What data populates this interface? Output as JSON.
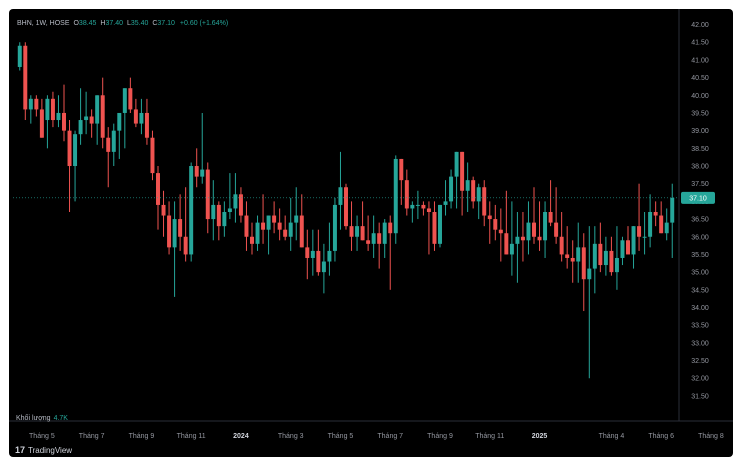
{
  "header": {
    "symbol": "BHN, 1W, HOSE",
    "open_label": "O",
    "open_value": "38.45",
    "high_label": "H",
    "high_value": "37.40",
    "low_label": "L",
    "low_value": "35.40",
    "close_label": "C",
    "close_value": "37.10",
    "change": "+0.60 (+1.64%)"
  },
  "volume": {
    "label": "Khối lượng",
    "value": "4.7K"
  },
  "branding": {
    "logo_mark": "17",
    "name": "TradingView"
  },
  "colors": {
    "up": "#26a69a",
    "down": "#ef5350",
    "background": "#000000",
    "axis_text": "#9598a1",
    "price_tag": "#26a69a"
  },
  "chart_data": {
    "type": "candlestick",
    "y_ticks": [
      "42.00",
      "41.50",
      "41.00",
      "40.50",
      "40.00",
      "39.50",
      "39.00",
      "38.50",
      "38.00",
      "37.50",
      "37.00",
      "36.50",
      "36.00",
      "35.50",
      "35.00",
      "34.50",
      "34.00",
      "33.50",
      "33.00",
      "32.50",
      "32.00",
      "31.50"
    ],
    "ylim": [
      31.3,
      42.1
    ],
    "current_price": "37.10",
    "x_labels": [
      "Tháng 5",
      "Tháng 7",
      "Tháng 9",
      "Tháng 11",
      "2024",
      "Tháng 3",
      "Tháng 5",
      "Tháng 7",
      "Tháng 9",
      "Tháng 11",
      "2025",
      "Tháng 4",
      "Tháng 6",
      "Tháng 8"
    ],
    "x_label_positions": [
      4,
      13,
      22,
      31,
      40,
      49,
      58,
      67,
      76,
      85,
      94,
      107,
      116,
      125
    ],
    "candles": [
      [
        40.8,
        41.5,
        40.7,
        41.4
      ],
      [
        41.4,
        41.5,
        39.3,
        39.6
      ],
      [
        39.6,
        40.0,
        39.2,
        39.9
      ],
      [
        39.9,
        40.0,
        39.4,
        39.6
      ],
      [
        39.6,
        39.9,
        38.8,
        38.8
      ],
      [
        39.3,
        40.0,
        38.5,
        39.9
      ],
      [
        39.9,
        40.1,
        39.1,
        39.3
      ],
      [
        39.3,
        40.0,
        39.1,
        39.5
      ],
      [
        39.5,
        40.3,
        38.7,
        39.0
      ],
      [
        39.0,
        39.3,
        36.7,
        38.0
      ],
      [
        38.0,
        39.0,
        37.0,
        38.9
      ],
      [
        38.9,
        40.2,
        38.6,
        39.3
      ],
      [
        39.3,
        40.1,
        38.9,
        39.4
      ],
      [
        39.4,
        39.6,
        38.8,
        39.2
      ],
      [
        39.2,
        40.0,
        38.6,
        40.0
      ],
      [
        40.0,
        40.5,
        38.5,
        38.8
      ],
      [
        38.8,
        39.1,
        37.4,
        38.4
      ],
      [
        38.4,
        39.2,
        38.0,
        39.0
      ],
      [
        39.0,
        39.5,
        38.2,
        39.5
      ],
      [
        39.5,
        40.0,
        38.5,
        40.2
      ],
      [
        40.2,
        40.5,
        39.5,
        39.6
      ],
      [
        39.6,
        39.9,
        39.1,
        39.2
      ],
      [
        39.2,
        39.9,
        38.9,
        39.5
      ],
      [
        39.5,
        39.9,
        38.6,
        38.8
      ],
      [
        38.8,
        39.0,
        37.6,
        37.8
      ],
      [
        37.8,
        38.0,
        36.2,
        36.9
      ],
      [
        36.9,
        37.3,
        36.0,
        36.6
      ],
      [
        36.6,
        37.0,
        35.5,
        35.7
      ],
      [
        35.7,
        37.0,
        34.3,
        36.5
      ],
      [
        36.5,
        37.2,
        35.6,
        36.0
      ],
      [
        36.0,
        37.4,
        35.3,
        35.5
      ],
      [
        35.5,
        38.1,
        35.3,
        38.0
      ],
      [
        38.0,
        38.5,
        37.4,
        37.7
      ],
      [
        37.7,
        39.5,
        37.5,
        37.9
      ],
      [
        37.9,
        38.1,
        36.1,
        36.5
      ],
      [
        36.5,
        37.6,
        35.9,
        36.9
      ],
      [
        36.9,
        37.0,
        35.9,
        36.3
      ],
      [
        36.3,
        37.0,
        36.0,
        36.7
      ],
      [
        36.7,
        37.8,
        36.5,
        36.8
      ],
      [
        36.8,
        37.8,
        36.4,
        37.2
      ],
      [
        37.2,
        37.4,
        36.4,
        36.6
      ],
      [
        36.6,
        37.0,
        35.6,
        36.0
      ],
      [
        36.0,
        36.4,
        35.5,
        35.8
      ],
      [
        35.8,
        36.6,
        35.6,
        36.4
      ],
      [
        36.4,
        37.2,
        35.8,
        36.2
      ],
      [
        36.2,
        36.6,
        35.5,
        36.6
      ],
      [
        36.6,
        37.0,
        36.1,
        36.4
      ],
      [
        36.4,
        36.8,
        35.9,
        36.2
      ],
      [
        36.2,
        36.6,
        35.9,
        36.0
      ],
      [
        36.0,
        37.1,
        35.6,
        36.4
      ],
      [
        36.4,
        37.4,
        35.9,
        36.6
      ],
      [
        36.6,
        37.2,
        35.7,
        35.7
      ],
      [
        35.7,
        36.2,
        34.8,
        35.4
      ],
      [
        35.4,
        36.2,
        34.9,
        35.6
      ],
      [
        35.6,
        36.2,
        34.9,
        35.0
      ],
      [
        35.0,
        35.8,
        34.4,
        35.3
      ],
      [
        35.3,
        36.4,
        34.9,
        35.6
      ],
      [
        35.6,
        37.1,
        35.3,
        36.9
      ],
      [
        36.9,
        38.4,
        36.2,
        37.4
      ],
      [
        37.4,
        37.5,
        36.2,
        36.3
      ],
      [
        36.3,
        37.0,
        35.6,
        36.0
      ],
      [
        36.0,
        36.6,
        35.6,
        36.3
      ],
      [
        36.3,
        37.0,
        35.9,
        35.9
      ],
      [
        35.9,
        36.6,
        35.6,
        35.8
      ],
      [
        35.8,
        36.6,
        35.4,
        36.1
      ],
      [
        36.1,
        36.4,
        35.1,
        35.8
      ],
      [
        35.8,
        36.5,
        35.4,
        36.4
      ],
      [
        36.4,
        36.6,
        34.5,
        36.1
      ],
      [
        36.1,
        38.3,
        35.8,
        38.2
      ],
      [
        38.2,
        38.0,
        36.9,
        37.6
      ],
      [
        37.6,
        37.9,
        36.6,
        36.8
      ],
      [
        36.8,
        37.0,
        36.4,
        36.9
      ],
      [
        36.9,
        37.3,
        36.5,
        36.9
      ],
      [
        36.9,
        37.0,
        36.6,
        36.8
      ],
      [
        36.8,
        37.0,
        35.5,
        36.7
      ],
      [
        36.7,
        37.0,
        35.6,
        35.8
      ],
      [
        35.8,
        36.8,
        35.7,
        36.9
      ],
      [
        36.9,
        37.6,
        36.6,
        37.0
      ],
      [
        37.0,
        37.9,
        36.8,
        37.7
      ],
      [
        37.7,
        38.4,
        36.8,
        38.4
      ],
      [
        38.4,
        38.4,
        36.6,
        37.3
      ],
      [
        37.3,
        38.1,
        36.7,
        37.6
      ],
      [
        37.6,
        37.7,
        36.8,
        37.0
      ],
      [
        37.0,
        37.5,
        36.5,
        37.4
      ],
      [
        37.4,
        37.6,
        36.3,
        36.6
      ],
      [
        36.6,
        37.0,
        35.8,
        36.5
      ],
      [
        36.5,
        36.9,
        35.9,
        36.2
      ],
      [
        36.2,
        36.8,
        35.3,
        36.1
      ],
      [
        36.1,
        37.3,
        35.5,
        35.5
      ],
      [
        35.5,
        37.0,
        34.9,
        35.8
      ],
      [
        35.8,
        36.7,
        34.7,
        36.0
      ],
      [
        36.0,
        36.7,
        35.3,
        35.9
      ],
      [
        35.9,
        37.0,
        35.5,
        36.4
      ],
      [
        36.4,
        37.4,
        35.8,
        36.0
      ],
      [
        36.0,
        37.0,
        35.6,
        35.9
      ],
      [
        35.9,
        37.0,
        35.4,
        36.7
      ],
      [
        36.7,
        37.6,
        36.3,
        36.4
      ],
      [
        36.4,
        37.4,
        35.8,
        36.0
      ],
      [
        36.0,
        36.7,
        35.3,
        35.5
      ],
      [
        35.5,
        36.3,
        35.1,
        35.4
      ],
      [
        35.4,
        35.9,
        34.7,
        35.3
      ],
      [
        35.3,
        36.4,
        34.7,
        35.7
      ],
      [
        35.7,
        36.1,
        33.9,
        34.8
      ],
      [
        34.8,
        36.3,
        32.0,
        35.1
      ],
      [
        35.1,
        36.3,
        34.4,
        35.8
      ],
      [
        35.8,
        36.4,
        35.0,
        35.2
      ],
      [
        35.2,
        36.0,
        34.9,
        35.6
      ],
      [
        35.6,
        36.0,
        34.9,
        35.0
      ],
      [
        35.0,
        36.3,
        34.5,
        35.4
      ],
      [
        35.4,
        36.0,
        35.2,
        35.9
      ],
      [
        35.9,
        36.3,
        35.5,
        35.5
      ],
      [
        35.5,
        36.2,
        35.1,
        36.3
      ],
      [
        36.3,
        37.5,
        35.6,
        36.0
      ],
      [
        36.0,
        36.7,
        35.5,
        36.0
      ],
      [
        36.0,
        37.2,
        35.7,
        36.7
      ],
      [
        36.7,
        37.0,
        36.3,
        36.6
      ],
      [
        36.6,
        37.0,
        36.1,
        36.1
      ],
      [
        36.1,
        36.8,
        35.9,
        36.4
      ],
      [
        36.4,
        37.5,
        35.4,
        37.1
      ]
    ]
  }
}
